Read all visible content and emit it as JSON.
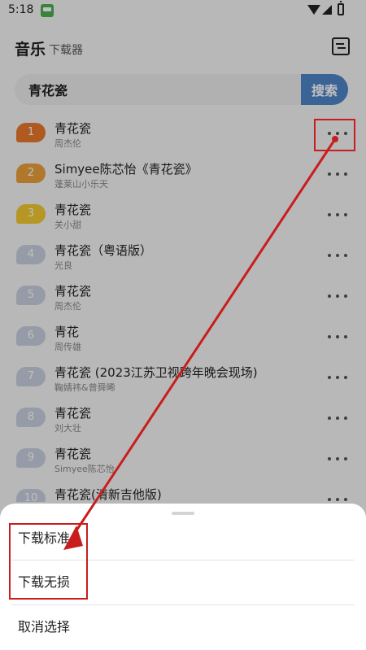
{
  "status": {
    "time": "5:18"
  },
  "header": {
    "title": "音乐",
    "subtitle": "下载器"
  },
  "search": {
    "value": "青花瓷",
    "button_label": "搜索"
  },
  "badge_colors": {
    "first": "#e9782d",
    "second": "#eba13d",
    "third": "#f3c931",
    "default": "#c8d0df"
  },
  "songs": [
    {
      "rank": "1",
      "title": "青花瓷",
      "artist": "周杰伦"
    },
    {
      "rank": "2",
      "title": "Simyee陈芯怡《青花瓷》",
      "artist": "蓬莱山小乐天"
    },
    {
      "rank": "3",
      "title": "青花瓷",
      "artist": "关小甜"
    },
    {
      "rank": "4",
      "title": "青花瓷（粤语版）",
      "artist": "光良"
    },
    {
      "rank": "5",
      "title": "青花瓷",
      "artist": "周杰伦"
    },
    {
      "rank": "6",
      "title": "青花",
      "artist": "周传雄"
    },
    {
      "rank": "7",
      "title": "青花瓷 (2023江苏卫视跨年晚会现场)",
      "artist": "鞠婧祎&曾舜晞"
    },
    {
      "rank": "8",
      "title": "青花瓷",
      "artist": "刘大壮"
    },
    {
      "rank": "9",
      "title": "青花瓷",
      "artist": "Simyee陈芯怡"
    },
    {
      "rank": "10",
      "title": "青花瓷(清新吉他版)",
      "artist": ""
    }
  ],
  "sheet": {
    "options": [
      "下载标准",
      "下载无损",
      "取消选择"
    ]
  },
  "annotation": {
    "color": "#c91d1d"
  }
}
